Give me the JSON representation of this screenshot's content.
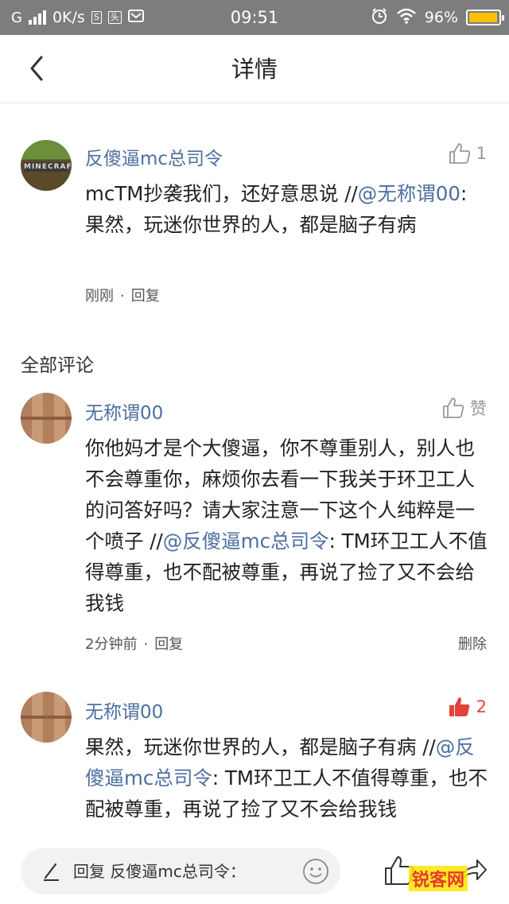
{
  "status_bar": {
    "network_speed": "0K/s",
    "time": "09:51",
    "battery": "96%",
    "battery_level": 0.96
  },
  "nav": {
    "title": "详情"
  },
  "main_comment": {
    "username": "反傻逼mc总司令",
    "likes": "1",
    "text_before": "mcTM抄袭我们，还好意思说 //",
    "mention": "@无称谓00",
    "text_after": ": 果然，玩迷你世界的人，都是脑子有病",
    "time": "刚刚",
    "reply_label": "回复",
    "avatar_text": "MINECRAFT"
  },
  "section_title": "全部评论",
  "comments": [
    {
      "username": "无称谓00",
      "like_label": "赞",
      "text_before": "你他妈才是个大傻逼，你不尊重别人，别人也不会尊重你，麻烦你去看一下我关于环卫工人的问答好吗？请大家注意一下这个人纯粹是一个喷子 //",
      "mention": "@反傻逼mc总司令",
      "text_after": ": TM环卫工人不值得尊重，也不配被尊重，再说了捡了又不会给我钱",
      "time": "2分钟前",
      "reply_label": "回复",
      "delete_label": "删除"
    },
    {
      "username": "无称谓00",
      "likes": "2",
      "text_before": "果然，玩迷你世界的人，都是脑子有病 //",
      "mention": "@反傻逼mc总司令",
      "text_after": ": TM环卫工人不值得尊重，也不配被尊重，再说了捡了又不会给我钱"
    }
  ],
  "bottom_bar": {
    "reply_placeholder": "回复 反傻逼mc总司令：",
    "watermark": "锐客网"
  },
  "colors": {
    "link_blue": "#4d6fa0",
    "like_red": "#e4413d",
    "status_bar": "#7d7d7d",
    "battery_yellow": "#ffc107"
  }
}
